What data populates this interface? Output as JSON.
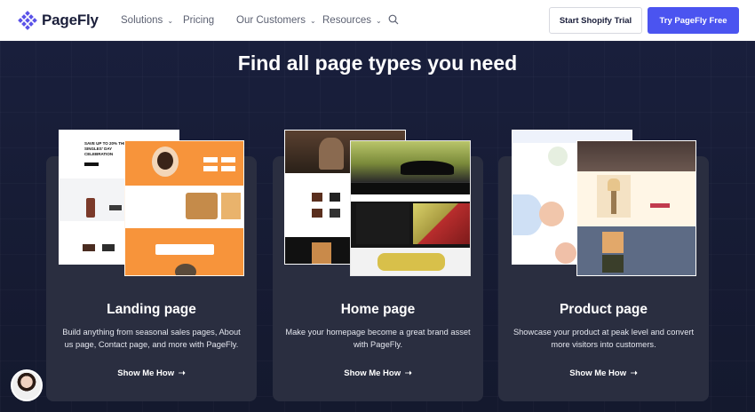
{
  "header": {
    "brand": "PageFly",
    "nav": [
      {
        "label": "Solutions",
        "has_dropdown": true
      },
      {
        "label": "Pricing",
        "has_dropdown": false
      },
      {
        "label": "Our Customers",
        "has_dropdown": true
      },
      {
        "label": "Resources",
        "has_dropdown": true
      }
    ],
    "trial_button": "Start Shopify Trial",
    "free_button": "Try PageFly Free"
  },
  "section": {
    "title": "Find all page types you need"
  },
  "cards": [
    {
      "title": "Landing page",
      "description": "Build anything from seasonal sales pages, About us page, Contact page, and more with PageFly.",
      "link": "Show Me How",
      "preview_texts": [
        "SAVE UP TO 20% THIS SINGLES' DAY CELEBRATION"
      ]
    },
    {
      "title": "Home page",
      "description": "Make your homepage become a great brand asset with PageFly.",
      "link": "Show Me How"
    },
    {
      "title": "Product page",
      "description": "Showcase your product at peak level and convert more visitors into customers.",
      "link": "Show Me How"
    }
  ],
  "colors": {
    "accent": "#4b54f0",
    "background": "#161b33",
    "card": "#2a2e40",
    "orange": "#f7943b"
  },
  "icons": {
    "search": "magnifier-icon",
    "arrow": "right-arrow-icon",
    "chevron": "chevron-down-icon"
  }
}
